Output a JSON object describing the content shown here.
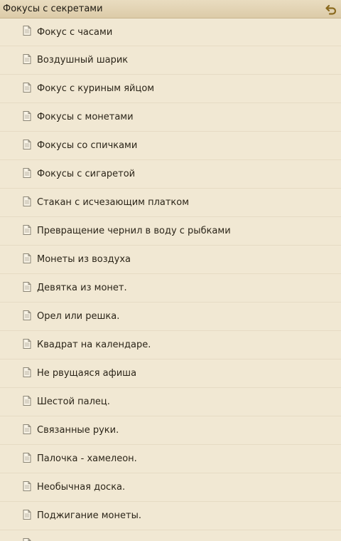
{
  "header": {
    "title": "Фокусы с секретами",
    "back_icon": "back-arrow-icon",
    "accent": "#8a6a1f"
  },
  "list": {
    "item_icon": "document-icon",
    "items": [
      {
        "label": "Фокус с часами"
      },
      {
        "label": "Воздушный шарик"
      },
      {
        "label": "Фокус с куриным яйцом"
      },
      {
        "label": "Фокусы с монетами"
      },
      {
        "label": "Фокусы со спичками"
      },
      {
        "label": "Фокусы с сигаретой"
      },
      {
        "label": "Стакан с исчезающим платком"
      },
      {
        "label": "Превращение чернил в воду с рыбками"
      },
      {
        "label": "Монеты из воздуха"
      },
      {
        "label": "Девятка из монет."
      },
      {
        "label": "Орел или решка."
      },
      {
        "label": "Квадрат на календаре."
      },
      {
        "label": "Не рвущаяся афиша"
      },
      {
        "label": "Шестой палец."
      },
      {
        "label": "Связанные руки."
      },
      {
        "label": "Палочка - хамелеон."
      },
      {
        "label": "Необычная доска."
      },
      {
        "label": "Поджигание монеты."
      },
      {
        "label": ""
      }
    ]
  }
}
